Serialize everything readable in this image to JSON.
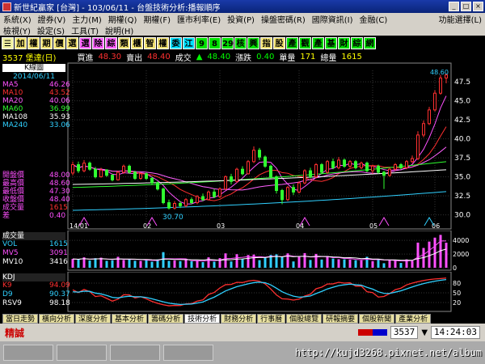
{
  "window": {
    "title": "新世紀贏家 [台灣] - 103/06/11 - 台盤技術分析:播報順序",
    "min": "_",
    "max": "□",
    "close": "×"
  },
  "menu": {
    "row1": [
      "系統(X)",
      "證券(V)",
      "主力(M)",
      "期權(Q)",
      "期權(F)",
      "匯市利率(E)",
      "投資(P)",
      "操盤密碼(R)",
      "國際資訊(I)",
      "金融(C)",
      "功能選擇(L)"
    ],
    "row1_right": "功能選擇(L)",
    "row2": [
      "檢視(Y)",
      "設定(S)",
      "工具(T)",
      "說明(H)"
    ]
  },
  "toolbar": {
    "buttons": [
      {
        "label": "☰",
        "bg": "#f0f0a0"
      },
      {
        "label": "加",
        "bg": "#f0e070"
      },
      {
        "label": "權",
        "bg": "#f0e070"
      },
      {
        "label": "期",
        "bg": "#f0e070"
      },
      {
        "label": "價",
        "bg": "#f0e070"
      },
      {
        "label": "選",
        "bg": "#f0e070"
      },
      {
        "label": "選",
        "bg": "#ff60ff"
      },
      {
        "label": "除",
        "bg": "#ff60ff"
      },
      {
        "label": "綜",
        "bg": "#ff60ff"
      },
      {
        "label": "類",
        "bg": "#f0e070"
      },
      {
        "label": "櫃",
        "bg": "#f0e070"
      },
      {
        "label": "智",
        "bg": "#f0e070"
      },
      {
        "label": "權",
        "bg": "#f0e070"
      },
      {
        "label": "委",
        "bg": "#00e0ff"
      },
      {
        "label": "江",
        "bg": "#00e0ff"
      },
      {
        "label": "9",
        "bg": "#00e000"
      },
      {
        "label": "8",
        "bg": "#00e000"
      },
      {
        "label": "29",
        "bg": "#00e000"
      },
      {
        "label": "核",
        "bg": "#00e000"
      },
      {
        "label": "興",
        "bg": "#00e000"
      },
      {
        "label": "指",
        "bg": "#f0e070"
      },
      {
        "label": "股",
        "bg": "#f0e070"
      },
      {
        "label": "產",
        "bg": "#00e000"
      },
      {
        "label": "觀",
        "bg": "#00e000"
      },
      {
        "label": "產",
        "bg": "#00e000"
      },
      {
        "label": "基",
        "bg": "#00e000"
      },
      {
        "label": "財",
        "bg": "#00e000"
      },
      {
        "label": "綜",
        "bg": "#00e000"
      },
      {
        "label": "網",
        "bg": "#00e000"
      }
    ]
  },
  "stock": {
    "code_name": "3537 堡達(日)",
    "buy_label": "買進",
    "buy": "48.30",
    "sell_label": "賣出",
    "sell": "48.40",
    "deal_label": "成交",
    "deal": "48.40",
    "change_label": "漲跌",
    "change": "0.40",
    "vol_label": "單量",
    "vol": "171",
    "total_label": "總量",
    "total": "1615"
  },
  "kchart": {
    "header": "K線圖",
    "date": "2014/06/11",
    "ma": [
      {
        "name": "MA5",
        "value": "46.26",
        "color": "#ff50ff"
      },
      {
        "name": "MA10",
        "value": "43.52",
        "color": "#ff3030"
      },
      {
        "name": "MA20",
        "value": "40.06",
        "color": "#ff60ff"
      },
      {
        "name": "MA60",
        "value": "36.99",
        "color": "#30ff30"
      },
      {
        "name": "MA108",
        "value": "35.93",
        "color": "#ffffff"
      },
      {
        "name": "MA240",
        "value": "33.06",
        "color": "#30d0ff"
      }
    ],
    "ohlc": [
      {
        "name": "開盤價",
        "value": "48.00"
      },
      {
        "name": "最高價",
        "value": "48.60"
      },
      {
        "name": "最低價",
        "value": "47.30"
      },
      {
        "name": "收盤價",
        "value": "48.40"
      },
      {
        "name": "成交量",
        "value": "1615"
      },
      {
        "name": "差",
        "value": "0.40"
      }
    ],
    "low_mark": "30.70",
    "high_mark": "48.60"
  },
  "volume_panel": {
    "header": "成交量",
    "items": [
      {
        "name": "VOL",
        "value": "1615",
        "color": "#30d0ff"
      },
      {
        "name": "MV5",
        "value": "3091",
        "color": "#ff50ff"
      },
      {
        "name": "MV10",
        "value": "3416",
        "color": "#ffffff"
      }
    ]
  },
  "kdj_panel": {
    "header": "KDJ",
    "items": [
      {
        "name": "K9",
        "value": "94.09",
        "color": "#ff3030"
      },
      {
        "name": "D9",
        "value": "90.37",
        "color": "#30d0ff"
      },
      {
        "name": "RSV9",
        "value": "98.18",
        "color": "#ffffff"
      }
    ]
  },
  "tabs": [
    "當日走勢",
    "橫向分析",
    "深度分析",
    "基本分析",
    "籌碼分析",
    "技術分析",
    "財務分析",
    "行事曆",
    "個股總覽",
    "研報摘要",
    "個股新聞",
    "產業分析"
  ],
  "status": {
    "label": "精誠",
    "code": "3537",
    "time": "14:24:03"
  },
  "taskbar": {
    "url": "http://kujd3268.pixnet.net/album"
  },
  "chart_data": [
    {
      "type": "candlestick",
      "title": "K線圖",
      "x_ticks": [
        "14/01",
        "02",
        "03",
        "04",
        "05",
        "06"
      ],
      "y_ticks": [
        30.0,
        32.5,
        35.0,
        37.5,
        40.0,
        42.5,
        45.0,
        47.5
      ],
      "ylim": [
        29,
        49
      ],
      "grid": true,
      "candles": [
        {
          "o": 35.5,
          "c": 36.6,
          "h": 37.0,
          "l": 35.2
        },
        {
          "o": 36.6,
          "c": 35.8,
          "h": 37.0,
          "l": 35.5
        },
        {
          "o": 35.8,
          "c": 36.8,
          "h": 37.2,
          "l": 35.6
        },
        {
          "o": 36.8,
          "c": 36.0,
          "h": 37.0,
          "l": 35.8
        },
        {
          "o": 36.0,
          "c": 35.0,
          "h": 36.3,
          "l": 34.8
        },
        {
          "o": 35.0,
          "c": 35.9,
          "h": 36.2,
          "l": 34.9
        },
        {
          "o": 35.9,
          "c": 35.2,
          "h": 36.0,
          "l": 35.0
        },
        {
          "o": 35.2,
          "c": 34.6,
          "h": 35.4,
          "l": 34.4
        },
        {
          "o": 34.6,
          "c": 35.6,
          "h": 35.8,
          "l": 34.5
        },
        {
          "o": 35.6,
          "c": 36.4,
          "h": 36.6,
          "l": 35.4
        },
        {
          "o": 36.4,
          "c": 35.6,
          "h": 36.6,
          "l": 35.4
        },
        {
          "o": 35.6,
          "c": 34.8,
          "h": 35.8,
          "l": 34.6
        },
        {
          "o": 34.8,
          "c": 35.4,
          "h": 35.6,
          "l": 34.6
        },
        {
          "o": 35.4,
          "c": 34.8,
          "h": 35.6,
          "l": 34.6
        },
        {
          "o": 34.8,
          "c": 34.2,
          "h": 35.0,
          "l": 34.0
        },
        {
          "o": 34.2,
          "c": 33.4,
          "h": 34.4,
          "l": 33.2
        },
        {
          "o": 33.4,
          "c": 31.6,
          "h": 33.6,
          "l": 31.4
        },
        {
          "o": 31.6,
          "c": 30.9,
          "h": 32.0,
          "l": 30.7
        },
        {
          "o": 30.9,
          "c": 31.5,
          "h": 31.8,
          "l": 30.7
        },
        {
          "o": 31.5,
          "c": 31.2,
          "h": 31.8,
          "l": 30.9
        },
        {
          "o": 31.2,
          "c": 32.0,
          "h": 32.2,
          "l": 31.0
        },
        {
          "o": 32.0,
          "c": 31.6,
          "h": 32.3,
          "l": 31.4
        },
        {
          "o": 31.6,
          "c": 32.4,
          "h": 32.6,
          "l": 31.4
        },
        {
          "o": 32.4,
          "c": 32.0,
          "h": 32.8,
          "l": 31.8
        },
        {
          "o": 32.0,
          "c": 33.0,
          "h": 33.2,
          "l": 31.9
        },
        {
          "o": 33.0,
          "c": 32.4,
          "h": 33.4,
          "l": 32.2
        },
        {
          "o": 32.4,
          "c": 33.4,
          "h": 33.6,
          "l": 32.2
        },
        {
          "o": 33.4,
          "c": 35.0,
          "h": 35.2,
          "l": 33.3
        },
        {
          "o": 35.0,
          "c": 34.4,
          "h": 35.4,
          "l": 34.0
        },
        {
          "o": 34.4,
          "c": 36.0,
          "h": 36.2,
          "l": 34.2
        },
        {
          "o": 36.0,
          "c": 35.4,
          "h": 36.4,
          "l": 35.2
        },
        {
          "o": 35.4,
          "c": 37.0,
          "h": 37.2,
          "l": 35.3
        },
        {
          "o": 37.0,
          "c": 38.5,
          "h": 39.0,
          "l": 36.8
        },
        {
          "o": 38.5,
          "c": 37.6,
          "h": 38.8,
          "l": 37.2
        },
        {
          "o": 37.6,
          "c": 36.4,
          "h": 37.8,
          "l": 36.2
        },
        {
          "o": 36.4,
          "c": 35.0,
          "h": 36.6,
          "l": 34.8
        },
        {
          "o": 35.0,
          "c": 33.2,
          "h": 35.2,
          "l": 32.8
        },
        {
          "o": 33.2,
          "c": 32.0,
          "h": 33.4,
          "l": 31.4
        },
        {
          "o": 32.0,
          "c": 33.6,
          "h": 33.8,
          "l": 31.8
        },
        {
          "o": 33.6,
          "c": 33.0,
          "h": 34.0,
          "l": 32.6
        },
        {
          "o": 33.0,
          "c": 34.2,
          "h": 34.4,
          "l": 32.8
        },
        {
          "o": 34.2,
          "c": 35.8,
          "h": 36.0,
          "l": 34.0
        },
        {
          "o": 35.8,
          "c": 35.0,
          "h": 36.2,
          "l": 34.8
        },
        {
          "o": 35.0,
          "c": 36.6,
          "h": 36.8,
          "l": 34.8
        },
        {
          "o": 36.6,
          "c": 35.6,
          "h": 36.8,
          "l": 35.4
        },
        {
          "o": 35.6,
          "c": 37.0,
          "h": 37.2,
          "l": 35.4
        },
        {
          "o": 37.0,
          "c": 36.2,
          "h": 37.4,
          "l": 36.0
        },
        {
          "o": 36.2,
          "c": 37.2,
          "h": 37.6,
          "l": 36.0
        },
        {
          "o": 37.2,
          "c": 36.4,
          "h": 37.4,
          "l": 36.2
        },
        {
          "o": 36.4,
          "c": 37.0,
          "h": 37.2,
          "l": 36.2
        },
        {
          "o": 37.0,
          "c": 36.2,
          "h": 37.2,
          "l": 36.0
        },
        {
          "o": 36.2,
          "c": 36.8,
          "h": 37.0,
          "l": 36.0
        },
        {
          "o": 36.8,
          "c": 35.8,
          "h": 37.0,
          "l": 35.6
        },
        {
          "o": 35.8,
          "c": 36.4,
          "h": 36.6,
          "l": 35.4
        },
        {
          "o": 36.4,
          "c": 35.6,
          "h": 36.6,
          "l": 35.4
        },
        {
          "o": 35.6,
          "c": 35.2,
          "h": 35.8,
          "l": 33.4
        },
        {
          "o": 35.2,
          "c": 36.0,
          "h": 36.2,
          "l": 35.0
        },
        {
          "o": 36.0,
          "c": 36.6,
          "h": 36.8,
          "l": 35.8
        },
        {
          "o": 36.6,
          "c": 36.2,
          "h": 36.8,
          "l": 36.0
        },
        {
          "o": 36.2,
          "c": 37.0,
          "h": 37.2,
          "l": 36.0
        },
        {
          "o": 37.0,
          "c": 37.4,
          "h": 37.8,
          "l": 36.8
        },
        {
          "o": 37.4,
          "c": 40.5,
          "h": 41.0,
          "l": 37.2
        },
        {
          "o": 40.5,
          "c": 42.0,
          "h": 42.4,
          "l": 40.2
        },
        {
          "o": 42.0,
          "c": 43.8,
          "h": 44.2,
          "l": 41.8
        },
        {
          "o": 43.8,
          "c": 46.0,
          "h": 46.4,
          "l": 43.6
        },
        {
          "o": 46.0,
          "c": 48.0,
          "h": 48.4,
          "l": 45.8
        },
        {
          "o": 48.0,
          "c": 48.4,
          "h": 48.6,
          "l": 47.3
        }
      ]
    }
  ]
}
